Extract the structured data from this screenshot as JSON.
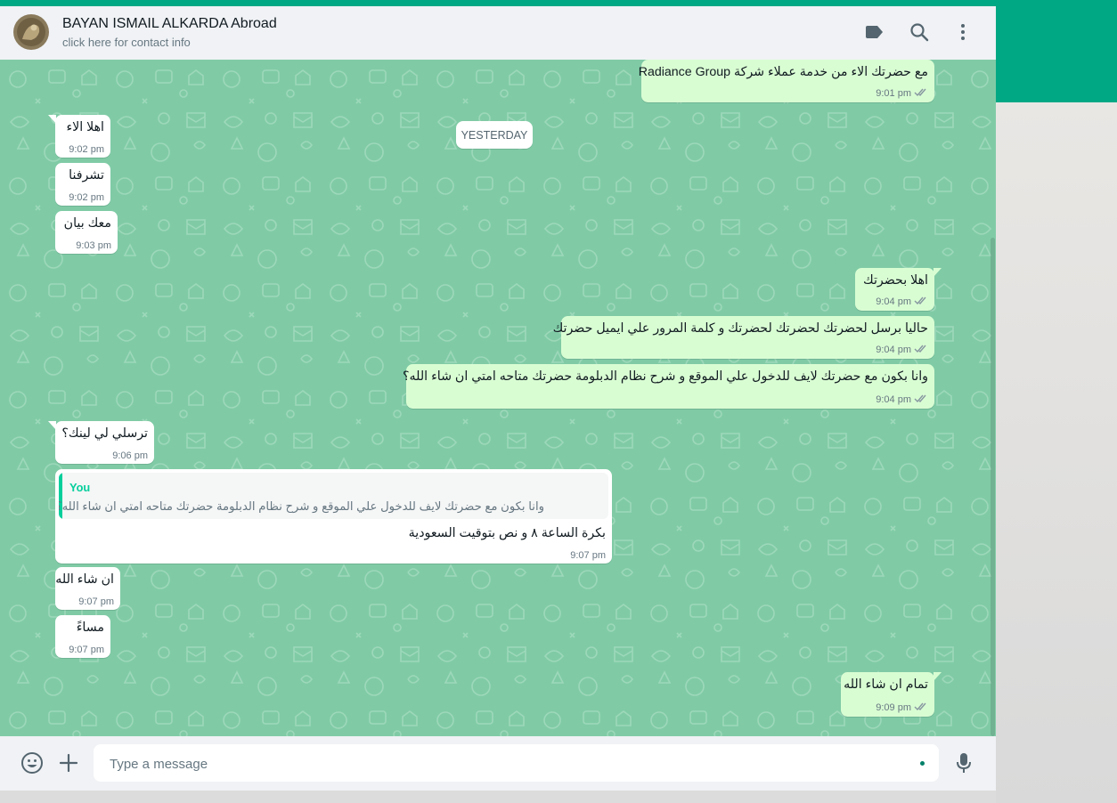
{
  "colors": {
    "accent": "#00a884",
    "outgoing_bubble": "#d9fdd3",
    "incoming_bubble": "#ffffff",
    "chat_background": "#80cba6",
    "quote_author": "#06cf9c"
  },
  "header": {
    "contact_name": "BAYAN ISMAIL ALKARDA Abroad",
    "contact_sub": "click here for contact info",
    "icons": [
      "label-icon",
      "search-icon",
      "more-options-icon"
    ]
  },
  "date_chip": "YESTERDAY",
  "messages": [
    {
      "dir": "out",
      "text": "مع حضرتك الاء من خدمة عملاء شركة Radiance Group",
      "time": "9:01 pm",
      "status": "read"
    },
    {
      "dir": "in",
      "text": "اهلا الاء",
      "time": "9:02 pm"
    },
    {
      "dir": "in",
      "text": "تشرفنا",
      "time": "9:02 pm"
    },
    {
      "dir": "in",
      "text": "معك بيان",
      "time": "9:03 pm"
    },
    {
      "dir": "out",
      "text": "اهلا بحضرتك",
      "time": "9:04 pm",
      "status": "read"
    },
    {
      "dir": "out",
      "text": "حاليا برسل لحضرتك لحضرتك لحضرتك و كلمة المرور علي ايميل حضرتك",
      "time": "9:04 pm",
      "status": "read"
    },
    {
      "dir": "out",
      "text": "وانا بكون مع حضرتك لايف للدخول علي الموقع و شرح نظام الدبلومة حضرتك متاحه امتي ان شاء الله؟",
      "time": "9:04 pm",
      "status": "read"
    },
    {
      "dir": "in",
      "text": "ترسلي لي لينك؟",
      "time": "9:06 pm"
    },
    {
      "dir": "in",
      "quote_author": "You",
      "quote_text": "وانا بكون مع حضرتك لايف للدخول علي الموقع و شرح نظام الدبلومة حضرتك متاحه امتي ان شاء الله؟",
      "text": "بكرة الساعة ٨ و نص بتوقيت السعودية",
      "time": "9:07 pm"
    },
    {
      "dir": "in",
      "text": "ان شاء الله",
      "time": "9:07 pm"
    },
    {
      "dir": "in",
      "text": "مساءً",
      "time": "9:07 pm"
    },
    {
      "dir": "out",
      "text": "تمام ان شاء الله",
      "time": "9:09 pm",
      "status": "read"
    }
  ],
  "footer": {
    "placeholder": "Type a message",
    "icons": [
      "emoji-icon",
      "attach-plus-icon",
      "microphone-icon"
    ]
  }
}
